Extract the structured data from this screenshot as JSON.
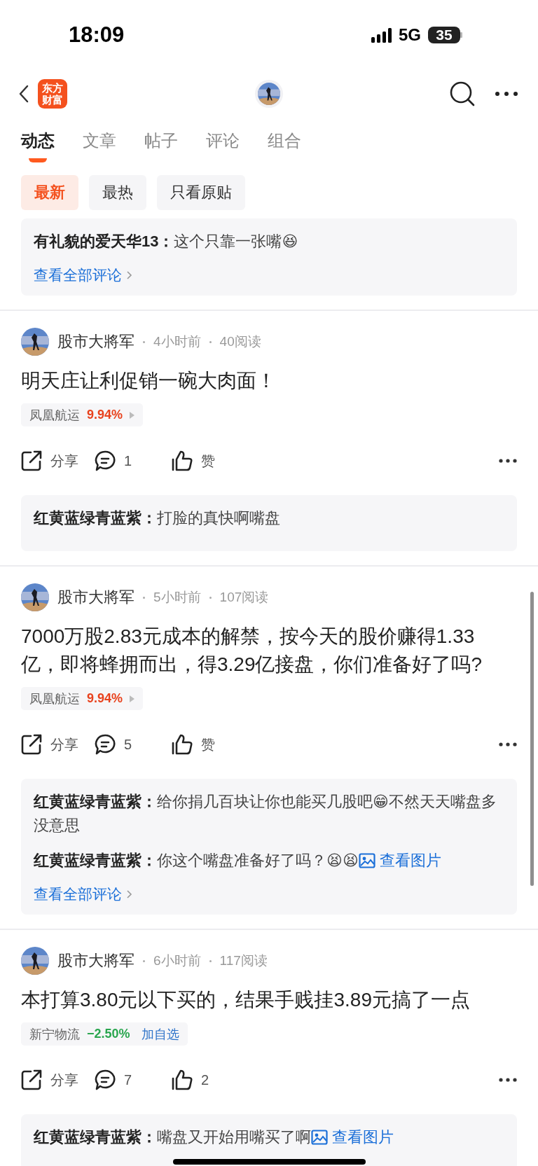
{
  "status_bar": {
    "time": "18:09",
    "network": "5G",
    "battery": "35"
  },
  "header": {
    "logo_lines": [
      "东方",
      "财富"
    ]
  },
  "tabs": [
    {
      "label": "动态",
      "selected": true
    },
    {
      "label": "文章",
      "selected": false
    },
    {
      "label": "帖子",
      "selected": false
    },
    {
      "label": "评论",
      "selected": false
    },
    {
      "label": "组合",
      "selected": false
    }
  ],
  "filters": [
    {
      "label": "最新",
      "selected": true
    },
    {
      "label": "最热",
      "selected": false
    },
    {
      "label": "只看原贴",
      "selected": false
    }
  ],
  "feed": [
    {
      "kind": "comments_tail",
      "comments": [
        {
          "text": "**有礼貌的爱天华13：**这个只靠一张嘴😆"
        }
      ],
      "more_link": "查看全部评论"
    },
    {
      "kind": "post",
      "author": "股市大將军",
      "time": "4小时前",
      "reads": "40阅读",
      "text": "明天庄让利促销一碗大肉面！",
      "stock": {
        "name": "凤凰航运",
        "change": "9.94%",
        "rising": true
      },
      "actions": {
        "share": "分享",
        "comments": "1",
        "likes": "赞"
      },
      "comments": [
        {
          "text": "**红黄蓝绿青蓝紫：**打脸的真快啊嘴盘"
        }
      ]
    },
    {
      "kind": "post",
      "author": "股市大將军",
      "time": "5小时前",
      "reads": "107阅读",
      "text": "7000万股2.83元成本的解禁，按今天的股价赚得1.33亿，即将蜂拥而出，得3.29亿接盘，你们准备好了吗?",
      "stock": {
        "name": "凤凰航运",
        "change": "9.94%",
        "rising": true
      },
      "actions": {
        "share": "分享",
        "comments": "5",
        "likes": "赞"
      },
      "comments": [
        {
          "text": "**红黄蓝绿青蓝紫：**给你捐几百块让你也能买几股吧😁不然天天嘴盘多没意思"
        },
        {
          "text": "**红黄蓝绿青蓝紫：**你这个嘴盘准备好了吗？😫😫",
          "image_link": "查看图片"
        }
      ],
      "more_link": "查看全部评论"
    },
    {
      "kind": "post",
      "author": "股市大將军",
      "time": "6小时前",
      "reads": "117阅读",
      "text": "本打算3.80元以下买的，结果手贱挂3.89元搞了一点",
      "stock": {
        "name": "新宁物流",
        "change": "−2.50%",
        "rising": false,
        "action": "加自选"
      },
      "actions": {
        "share": "分享",
        "comments": "7",
        "likes": "2"
      },
      "comments": [
        {
          "text": "**红黄蓝绿青蓝紫：**嘴盘又开始用嘴买了啊",
          "image_link": "查看图片"
        }
      ]
    }
  ]
}
